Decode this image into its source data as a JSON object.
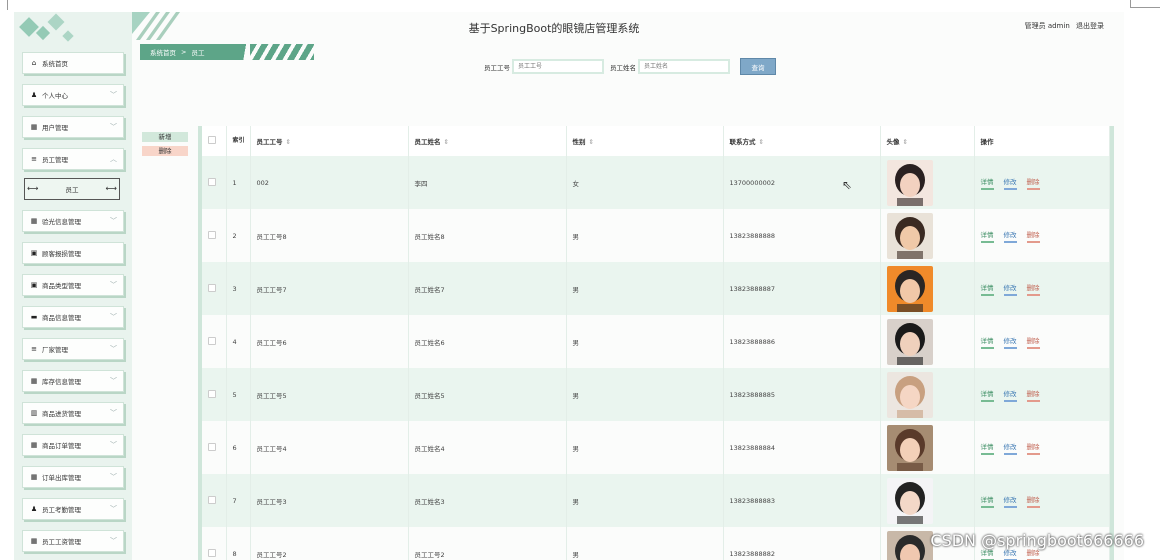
{
  "header": {
    "title": "基于SpringBoot的眼镜店管理系统",
    "user_label": "管理员 admin",
    "logout": "退出登录"
  },
  "breadcrumb": {
    "home": "系统首页",
    "sep": ">",
    "current": "员工"
  },
  "sidebar": {
    "items": [
      {
        "label": "系统首页",
        "icon": "home-icon",
        "glyph": "⌂",
        "chevron": false
      },
      {
        "label": "个人中心",
        "icon": "user-icon",
        "glyph": "♟",
        "chevron": true
      },
      {
        "label": "用户管理",
        "icon": "grid-icon",
        "glyph": "▦",
        "chevron": true
      },
      {
        "label": "员工管理",
        "icon": "list-icon",
        "glyph": "≡",
        "chevron": true,
        "expanded": true
      },
      {
        "label": "验光信息管理",
        "icon": "grid-icon",
        "glyph": "▦",
        "chevron": true
      },
      {
        "label": "顾客报损管理",
        "icon": "clipboard-icon",
        "glyph": "▣",
        "chevron": false
      },
      {
        "label": "商品类型管理",
        "icon": "bag-icon",
        "glyph": "▣",
        "chevron": true
      },
      {
        "label": "商品信息管理",
        "icon": "monitor-icon",
        "glyph": "▬",
        "chevron": true
      },
      {
        "label": "厂家管理",
        "icon": "list-icon",
        "glyph": "≡",
        "chevron": true
      },
      {
        "label": "库存信息管理",
        "icon": "grid-icon",
        "glyph": "▦",
        "chevron": true
      },
      {
        "label": "商品进货管理",
        "icon": "chart-icon",
        "glyph": "▥",
        "chevron": true
      },
      {
        "label": "商品订单管理",
        "icon": "grid-icon",
        "glyph": "▦",
        "chevron": true
      },
      {
        "label": "订单出库管理",
        "icon": "grid-icon",
        "glyph": "▦",
        "chevron": true
      },
      {
        "label": "员工考勤管理",
        "icon": "user-icon",
        "glyph": "♟",
        "chevron": true
      },
      {
        "label": "员工工资管理",
        "icon": "grid-icon",
        "glyph": "▦",
        "chevron": true
      }
    ],
    "submenu": "员工"
  },
  "search": {
    "id_label": "员工工号",
    "id_placeholder": "员工工号",
    "name_label": "员工姓名",
    "name_placeholder": "员工姓名",
    "button": "查询"
  },
  "actions": {
    "add": "新增",
    "delete": "删除"
  },
  "table": {
    "columns": [
      "索引",
      "员工工号",
      "员工姓名",
      "性别",
      "联系方式",
      "头像",
      "操作"
    ],
    "rows": [
      {
        "idx": "1",
        "id": "002",
        "name": "李四",
        "gender": "女",
        "phone": "13700000002"
      },
      {
        "idx": "2",
        "id": "员工工号8",
        "name": "员工姓名8",
        "gender": "男",
        "phone": "13823888888"
      },
      {
        "idx": "3",
        "id": "员工工号7",
        "name": "员工姓名7",
        "gender": "男",
        "phone": "13823888887"
      },
      {
        "idx": "4",
        "id": "员工工号6",
        "name": "员工姓名6",
        "gender": "男",
        "phone": "13823888886"
      },
      {
        "idx": "5",
        "id": "员工工号5",
        "name": "员工姓名5",
        "gender": "男",
        "phone": "13823888885"
      },
      {
        "idx": "6",
        "id": "员工工号4",
        "name": "员工姓名4",
        "gender": "男",
        "phone": "13823888884"
      },
      {
        "idx": "7",
        "id": "员工工号3",
        "name": "员工姓名3",
        "gender": "男",
        "phone": "13823888883"
      },
      {
        "idx": "8",
        "id": "员工工号2",
        "name": "员工工号2",
        "gender": "男",
        "phone": "13823888882"
      }
    ],
    "ops": {
      "detail": "详情",
      "edit": "修改",
      "remove": "删除"
    }
  },
  "watermark": "CSDN @springboot666666",
  "colors": {
    "accent": "#5da588",
    "sidebar_bg": "#e9f3ee",
    "row_alt": "#eaf5ef",
    "search_btn": "#7fa8c8"
  }
}
